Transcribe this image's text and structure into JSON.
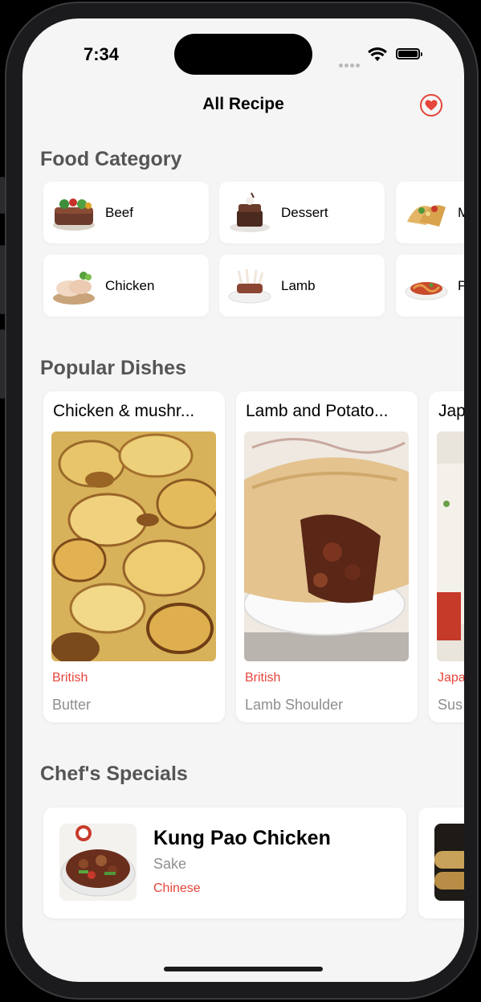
{
  "status_bar": {
    "time": "7:34"
  },
  "nav": {
    "title": "All Recipe",
    "favorite_icon": "heart-icon"
  },
  "sections": {
    "category_title": "Food Category",
    "popular_title": "Popular  Dishes",
    "specials_title": "Chef's Specials"
  },
  "categories": [
    {
      "label": "Beef"
    },
    {
      "label": "Dessert"
    },
    {
      "label": "M"
    },
    {
      "label": "Chicken"
    },
    {
      "label": "Lamb"
    },
    {
      "label": "P"
    }
  ],
  "popular_dishes": [
    {
      "title": "Chicken & mushr...",
      "area": "British",
      "ingredient": "Butter"
    },
    {
      "title": "Lamb and Potato...",
      "area": "British",
      "ingredient": "Lamb Shoulder"
    },
    {
      "title": "Jap",
      "area": "Japa",
      "ingredient": "Sus"
    }
  ],
  "chef_specials": [
    {
      "name": "Kung Pao Chicken",
      "sub": "Sake",
      "area": "Chinese"
    }
  ],
  "colors": {
    "accent": "#e5453a",
    "background": "#f5f5f5",
    "secondary_text": "#8e8e93"
  }
}
